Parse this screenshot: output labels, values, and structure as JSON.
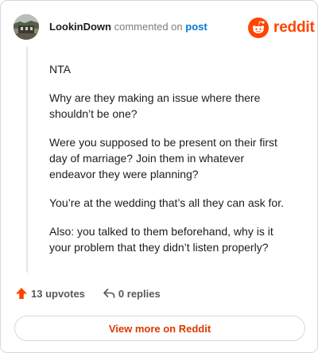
{
  "comment": {
    "username": "LookinDown",
    "action_text": "commented on",
    "post_link_label": "post",
    "paragraphs": [
      "NTA",
      "Why are they making an issue where there shouldn’t be one?",
      "Were you supposed to be present on their first day of marriage? Join them in whatever endeavor they were planning?",
      "You’re at the wedding that’s all they can ask for.",
      "Also: you talked to them beforehand, why is it your problem that they didn’t listen properly?"
    ],
    "upvotes_label": "13 upvotes",
    "replies_label": "0 replies"
  },
  "brand": {
    "name": "reddit",
    "logo_icon": "reddit-snoo-icon",
    "color": "#ff4500"
  },
  "footer": {
    "view_more_label": "View more on Reddit",
    "accent": "#d93a00"
  }
}
